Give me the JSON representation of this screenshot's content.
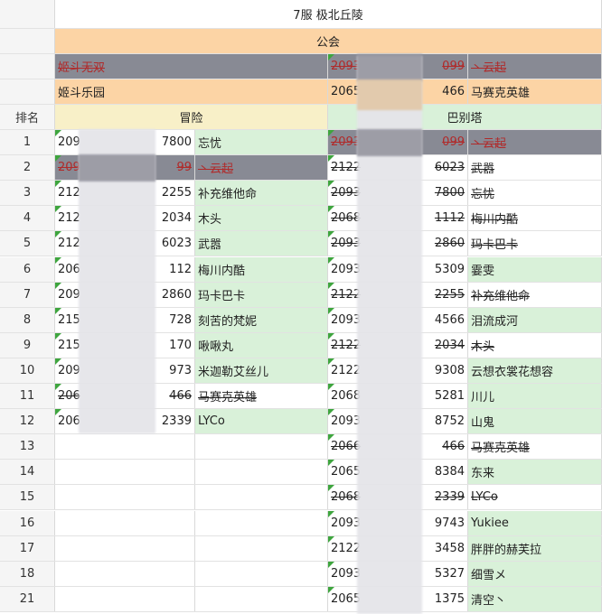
{
  "title": "7服 极北丘陵",
  "guild_header": "公会",
  "guild_rows": [
    {
      "name": "姬斗无双",
      "id": "2093",
      "id_suffix": "099",
      "leader": "丶云起",
      "struck": true
    },
    {
      "name": "姬斗乐园",
      "id": "2065",
      "id_suffix": "466",
      "leader": "马赛克英雄",
      "struck": false
    }
  ],
  "rank_header": "排名",
  "section_left": "冒险",
  "section_right": "巴别塔",
  "rows": [
    {
      "rank": "1",
      "lid": "209",
      "lsuf": "7800",
      "lname": "忘忧",
      "lstrike": false,
      "lgray": false,
      "lbg": "green",
      "rid": "2093",
      "rsuf": "099",
      "rname": "丶云起",
      "rstrike": true,
      "rgray": true,
      "rbg": "gray"
    },
    {
      "rank": "2",
      "lid": "209",
      "lsuf": "99",
      "lname": "丶云起",
      "lstrike": true,
      "lgray": true,
      "lbg": "gray",
      "rid": "2122",
      "rsuf": "6023",
      "rname": "武嚣",
      "rstrike": true,
      "rgray": false,
      "rbg": "white"
    },
    {
      "rank": "3",
      "lid": "212",
      "lsuf": "2255",
      "lname": "补充维他命",
      "lstrike": false,
      "lgray": false,
      "lbg": "green",
      "rid": "2093",
      "rsuf": "7800",
      "rname": "忘忧",
      "rstrike": true,
      "rgray": false,
      "rbg": "white"
    },
    {
      "rank": "4",
      "lid": "212",
      "lsuf": "2034",
      "lname": "木头",
      "lstrike": false,
      "lgray": false,
      "lbg": "green",
      "rid": "2068",
      "rsuf": "1112",
      "rname": "梅川内酷",
      "rstrike": true,
      "rgray": false,
      "rbg": "white"
    },
    {
      "rank": "5",
      "lid": "212",
      "lsuf": "6023",
      "lname": "武嚣",
      "lstrike": false,
      "lgray": false,
      "lbg": "green",
      "rid": "2093",
      "rsuf": "2860",
      "rname": "玛卡巴卡",
      "rstrike": true,
      "rgray": false,
      "rbg": "white"
    },
    {
      "rank": "6",
      "lid": "206",
      "lsuf": "112",
      "lname": "梅川内酷",
      "lstrike": false,
      "lgray": false,
      "lbg": "green",
      "rid": "2093",
      "rsuf": "5309",
      "rname": "霎雯",
      "rstrike": false,
      "rgray": false,
      "rbg": "green"
    },
    {
      "rank": "7",
      "lid": "209",
      "lsuf": "2860",
      "lname": "玛卡巴卡",
      "lstrike": false,
      "lgray": false,
      "lbg": "green",
      "rid": "2122",
      "rsuf": "2255",
      "rname": "补充维他命",
      "rstrike": true,
      "rgray": false,
      "rbg": "white"
    },
    {
      "rank": "8",
      "lid": "215",
      "lsuf": "728",
      "lname": "刻苦的梵妮",
      "lstrike": false,
      "lgray": false,
      "lbg": "green",
      "rid": "2093",
      "rsuf": "4566",
      "rname": "泪流成河",
      "rstrike": false,
      "rgray": false,
      "rbg": "green"
    },
    {
      "rank": "9",
      "lid": "215",
      "lsuf": "170",
      "lname": "啾啾丸",
      "lstrike": false,
      "lgray": false,
      "lbg": "green",
      "rid": "2122",
      "rsuf": "2034",
      "rname": "木头",
      "rstrike": true,
      "rgray": false,
      "rbg": "white"
    },
    {
      "rank": "10",
      "lid": "209",
      "lsuf": "973",
      "lname": "米迦勒艾丝儿",
      "lstrike": false,
      "lgray": false,
      "lbg": "green",
      "rid": "2122",
      "rsuf": "9308",
      "rname": "云想衣裳花想容",
      "rstrike": false,
      "rgray": false,
      "rbg": "green"
    },
    {
      "rank": "11",
      "lid": "206",
      "lsuf": "466",
      "lname": "马赛克英雄",
      "lstrike": true,
      "lgray": false,
      "lbg": "white",
      "rid": "2068",
      "rsuf": "5281",
      "rname": "川儿",
      "rstrike": false,
      "rgray": false,
      "rbg": "green"
    },
    {
      "rank": "12",
      "lid": "206",
      "lsuf": "2339",
      "lname": "LYCo",
      "lstrike": false,
      "lgray": false,
      "lbg": "green",
      "rid": "2093",
      "rsuf": "8752",
      "rname": "山鬼",
      "rstrike": false,
      "rgray": false,
      "rbg": "green"
    },
    {
      "rank": "13",
      "lid": "",
      "lsuf": "",
      "lname": "",
      "lstrike": false,
      "lgray": false,
      "lbg": "white",
      "rid": "2066",
      "rsuf": "466",
      "rname": "马赛克英雄",
      "rstrike": true,
      "rgray": false,
      "rbg": "white"
    },
    {
      "rank": "14",
      "lid": "",
      "lsuf": "",
      "lname": "",
      "lstrike": false,
      "lgray": false,
      "lbg": "white",
      "rid": "2065",
      "rsuf": "8384",
      "rname": "东来",
      "rstrike": false,
      "rgray": false,
      "rbg": "green"
    },
    {
      "rank": "15",
      "lid": "",
      "lsuf": "",
      "lname": "",
      "lstrike": false,
      "lgray": false,
      "lbg": "white",
      "rid": "2068",
      "rsuf": "2339",
      "rname": "LYCo",
      "rstrike": true,
      "rgray": false,
      "rbg": "white"
    },
    {
      "rank": "16",
      "lid": "",
      "lsuf": "",
      "lname": "",
      "lstrike": false,
      "lgray": false,
      "lbg": "white",
      "rid": "2093",
      "rsuf": "9743",
      "rname": "Yukiee",
      "rstrike": false,
      "rgray": false,
      "rbg": "green"
    },
    {
      "rank": "17",
      "lid": "",
      "lsuf": "",
      "lname": "",
      "lstrike": false,
      "lgray": false,
      "lbg": "white",
      "rid": "2122",
      "rsuf": "3458",
      "rname": "胖胖的赫芙拉",
      "rstrike": false,
      "rgray": false,
      "rbg": "green"
    },
    {
      "rank": "18",
      "lid": "",
      "lsuf": "",
      "lname": "",
      "lstrike": false,
      "lgray": false,
      "lbg": "white",
      "rid": "2093",
      "rsuf": "5327",
      "rname": "细雪メ",
      "rstrike": false,
      "rgray": false,
      "rbg": "green"
    },
    {
      "rank": "21",
      "lid": "",
      "lsuf": "",
      "lname": "",
      "lstrike": false,
      "lgray": false,
      "lbg": "white",
      "rid": "2065",
      "rsuf": "1375",
      "rname": "清空丶",
      "rstrike": false,
      "rgray": false,
      "rbg": "green"
    }
  ]
}
